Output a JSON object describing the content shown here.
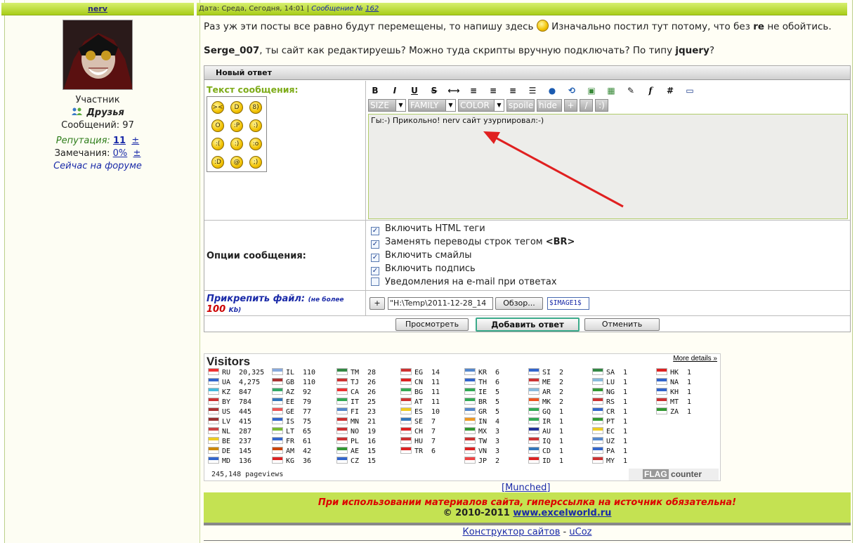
{
  "post": {
    "author": "nerv",
    "date_line": "Дата: Среда, Сегодня, 14:01",
    "sep": "|",
    "msg_prefix": "Сообщение №",
    "msg_no": "162",
    "line1_a": "Раз уж эти посты все равно будут перемещены, то напишу здесь",
    "line1_b": "Изначально постил тут потому, что без",
    "line1_bold": "re",
    "line1_c": "не обойтись.",
    "line2_user": "Serge_007",
    "line2_a": ", ты сайт как редактируешь? Можно туда скрипты вручную подключать? По типу",
    "line2_bold": "jquery",
    "line2_q": "?"
  },
  "user": {
    "rank": "Участник",
    "group": "Друзья",
    "posts": "Сообщений: 97",
    "rep_label": "Репутация:",
    "rep_value": "11",
    "pm": "±",
    "warn_label": "Замечания:",
    "warn_value": "0%",
    "online": "Сейчас на форуме"
  },
  "reply": {
    "title": "Новый ответ",
    "text_label": "Текст сообщения:",
    "toolbar": [
      "B",
      "I",
      "U",
      "S",
      "⟷",
      "≡",
      "≡",
      "≡",
      "☰",
      "●",
      "⟲",
      "▣",
      "▦",
      "✎",
      "f",
      "#",
      "▭"
    ],
    "dropdowns": [
      "SIZE",
      "FAMILY",
      "COLOR"
    ],
    "buttons": [
      "spoile",
      "hide",
      "+",
      "/",
      ":)"
    ],
    "textarea_value": "Гы:-) Прикольно! nerv сайт узурпировал:-)",
    "options_label": "Опции сообщения:",
    "options": [
      {
        "label": "Включить HTML теги",
        "checked": true
      },
      {
        "label": "Заменять переводы строк тегом ",
        "bold": "<BR>",
        "checked": true
      },
      {
        "label": "Включить смайлы",
        "checked": true
      },
      {
        "label": "Включить подпись",
        "checked": true
      },
      {
        "label": "Уведомления на e-mail при ответах",
        "checked": false
      }
    ],
    "attach_label": "Прикрепить файл:",
    "attach_note": "(не более",
    "attach_limit": "100",
    "attach_unit": "Kb)",
    "plus": "+",
    "file_value": "\"H:\\Temp\\2011-12-28_14",
    "browse": "Обзор...",
    "image_tag": "$IMAGE1$",
    "preview_btn": "Просмотреть",
    "submit_btn": "Добавить ответ",
    "cancel_btn": "Отменить"
  },
  "visitors": {
    "title": "Visitors",
    "more": "More details »",
    "pageviews": "245,148 pageviews",
    "counter_flag": "FLAG",
    "counter_text": "counter",
    "columns": [
      [
        [
          "RU",
          "20,325",
          "#e33"
        ],
        [
          "UA",
          "4,275",
          "#36c"
        ],
        [
          "KZ",
          "847",
          "#4bd"
        ],
        [
          "BY",
          "784",
          "#c33"
        ],
        [
          "US",
          "445",
          "#a33"
        ],
        [
          "LV",
          "415",
          "#933"
        ],
        [
          "NL",
          "287",
          "#c44"
        ],
        [
          "BE",
          "237",
          "#ec2"
        ],
        [
          "DE",
          "145",
          "#c80"
        ],
        [
          "MD",
          "136",
          "#36c"
        ]
      ],
      [
        [
          "IL",
          "110",
          "#8ad"
        ],
        [
          "GB",
          "110",
          "#a33"
        ],
        [
          "AZ",
          "92",
          "#3a6"
        ],
        [
          "EE",
          "79",
          "#37b"
        ],
        [
          "GE",
          "77",
          "#e55"
        ],
        [
          "IS",
          "75",
          "#36c"
        ],
        [
          "LT",
          "65",
          "#7b3"
        ],
        [
          "FR",
          "61",
          "#36c"
        ],
        [
          "AM",
          "42",
          "#c40"
        ],
        [
          "KG",
          "36",
          "#d22"
        ]
      ],
      [
        [
          "TM",
          "28",
          "#384"
        ],
        [
          "TJ",
          "26",
          "#c33"
        ],
        [
          "CA",
          "26",
          "#e33"
        ],
        [
          "IT",
          "25",
          "#3a5"
        ],
        [
          "FI",
          "23",
          "#58c"
        ],
        [
          "MN",
          "21",
          "#c33"
        ],
        [
          "NO",
          "19",
          "#c33"
        ],
        [
          "PL",
          "16",
          "#c33"
        ],
        [
          "AE",
          "15",
          "#393"
        ],
        [
          "CZ",
          "15",
          "#36c"
        ]
      ],
      [
        [
          "EG",
          "14",
          "#c33"
        ],
        [
          "CN",
          "11",
          "#d22"
        ],
        [
          "BG",
          "11",
          "#3a5"
        ],
        [
          "AT",
          "11",
          "#c33"
        ],
        [
          "ES",
          "10",
          "#ec2"
        ],
        [
          "SE",
          "7",
          "#37b"
        ],
        [
          "CH",
          "7",
          "#d22"
        ],
        [
          "HU",
          "7",
          "#c33"
        ],
        [
          "TR",
          "6",
          "#d22"
        ]
      ],
      [
        [
          "KR",
          "6",
          "#58c"
        ],
        [
          "TH",
          "6",
          "#36c"
        ],
        [
          "IE",
          "5",
          "#3a5"
        ],
        [
          "BR",
          "5",
          "#3a5"
        ],
        [
          "GR",
          "5",
          "#58c"
        ],
        [
          "IN",
          "4",
          "#e92"
        ],
        [
          "MX",
          "3",
          "#393"
        ],
        [
          "TW",
          "3",
          "#c33"
        ],
        [
          "VN",
          "3",
          "#d22"
        ],
        [
          "JP",
          "2",
          "#e44"
        ]
      ],
      [
        [
          "SI",
          "2",
          "#36c"
        ],
        [
          "ME",
          "2",
          "#c33"
        ],
        [
          "AR",
          "2",
          "#8bd"
        ],
        [
          "MK",
          "2",
          "#e52"
        ],
        [
          "GQ",
          "1",
          "#3a5"
        ],
        [
          "IR",
          "1",
          "#3a5"
        ],
        [
          "AU",
          "1",
          "#239"
        ],
        [
          "IQ",
          "1",
          "#c33"
        ],
        [
          "CD",
          "1",
          "#37b"
        ],
        [
          "ID",
          "1",
          "#d22"
        ]
      ],
      [
        [
          "SA",
          "1",
          "#384"
        ],
        [
          "LU",
          "1",
          "#8bd"
        ],
        [
          "NG",
          "1",
          "#393"
        ],
        [
          "RS",
          "1",
          "#c33"
        ],
        [
          "CR",
          "1",
          "#36c"
        ],
        [
          "PT",
          "1",
          "#393"
        ],
        [
          "EC",
          "1",
          "#ec2"
        ],
        [
          "UZ",
          "1",
          "#58c"
        ],
        [
          "PA",
          "1",
          "#36c"
        ],
        [
          "MY",
          "1",
          "#c33"
        ]
      ],
      [
        [
          "HK",
          "1",
          "#d22"
        ],
        [
          "NA",
          "1",
          "#36c"
        ],
        [
          "KH",
          "1",
          "#36c"
        ],
        [
          "MT",
          "1",
          "#c33"
        ],
        [
          "ZA",
          "1",
          "#393"
        ]
      ]
    ]
  },
  "footer": {
    "munched": "[Munched]",
    "warning": "При использовании материалов сайта, гиперссылка на источник обязательна!",
    "copy_prefix": "© 2010-2011",
    "site": "www.excelworld.ru",
    "constructor": "Конструктор сайтов",
    "dash": "-",
    "ucoz": "uCoz"
  }
}
